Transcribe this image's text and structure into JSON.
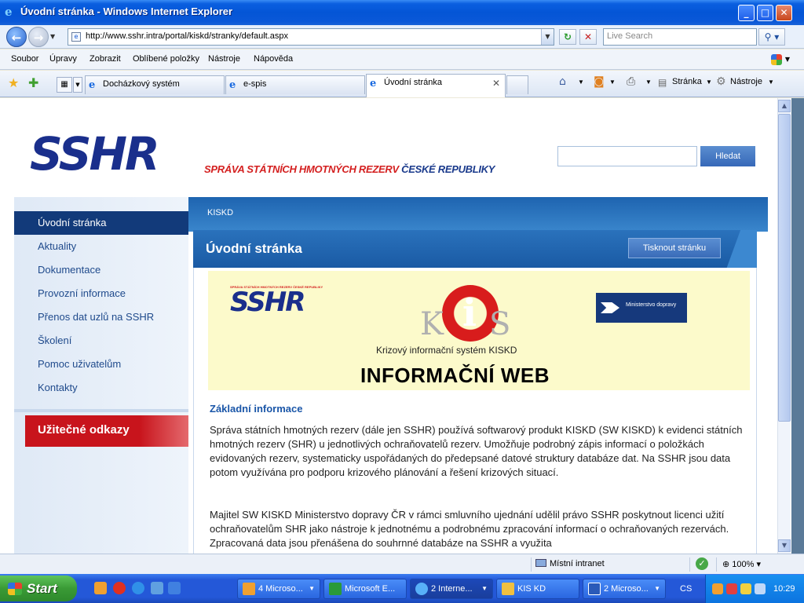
{
  "window": {
    "title": "Úvodní stránka - Windows Internet Explorer",
    "minimize": "_",
    "maximize": "□",
    "close": "✕"
  },
  "address": {
    "url": "http://www.sshr.intra/portal/kiskd/stranky/default.aspx",
    "search_placeholder": "Live Search"
  },
  "menu": {
    "items": [
      "Soubor",
      "Úpravy",
      "Zobrazit",
      "Oblíbené položky",
      "Nástroje",
      "Nápověda"
    ]
  },
  "tabs": {
    "items": [
      {
        "label": "Docházkový systém"
      },
      {
        "label": "e-spis"
      },
      {
        "label": "Úvodní stránka"
      }
    ],
    "commands": {
      "page": "Stránka",
      "tools": "Nástroje"
    }
  },
  "site": {
    "logo_text": "SSHR",
    "tagline_red": "SPRÁVA STÁTNÍCH HMOTNÝCH REZERV",
    "tagline_blue": "ČESKÉ REPUBLIKY",
    "search_button": "Hledat",
    "nav": [
      "Úvodní stránka",
      "Aktuality",
      "Dokumentace",
      "Provozní informace",
      "Přenos dat uzlů na SSHR",
      "Školení",
      "Pomoc uživatelům",
      "Kontakty"
    ],
    "useful_links": "Užitečné odkazy",
    "breadcrumb": "KISKD",
    "page_title": "Úvodní stránka",
    "print_button": "Tisknout stránku",
    "banner": {
      "mini_logo_caption": "SPRÁVA STÁTNÍCH HMOTNÝCH REZERV ČESKÉ REPUBLIKY",
      "mini_logo": "SSHR",
      "kis_name": "Krizový informační systém KISKD",
      "heading": "INFORMAČNÍ WEB",
      "ministry": "Ministerstvo dopravy"
    },
    "section_heading": "Základní informace",
    "paragraphs": [
      "Správa státních hmotných rezerv (dále jen SSHR) používá softwarový produkt KISKD (SW KISKD) k evidenci státních hmotných rezerv (SHR) u jednotlivých ochraňovatelů rezerv. Umožňuje podrobný zápis informací o položkách evidovaných rezerv, systematicky uspořádaných do předepsané datové struktury databáze dat. Na SSHR jsou data potom využívána pro podporu krizového plánování a řešení krizových situací.",
      "Majitel SW KISKD Ministerstvo dopravy ČR v rámci smluvního ujednání udělil právo SSHR poskytnout licenci užití ochraňovatelům SHR jako nástroje k  jednotnému a podrobnému zpracování informací o ochraňovaných rezervách.  Zpracovaná data  jsou přenášena  do souhrnné databáze na SSHR a využita"
    ]
  },
  "status": {
    "zone": "Místní intranet",
    "zoom": "100%"
  },
  "taskbar": {
    "start": "Start",
    "buttons": [
      {
        "label": "4 Microso..."
      },
      {
        "label": "Microsoft E..."
      },
      {
        "label": "2 Interne..."
      },
      {
        "label": "KIS KD"
      },
      {
        "label": "2 Microso..."
      }
    ],
    "lang": "CS",
    "clock": "10:29"
  }
}
